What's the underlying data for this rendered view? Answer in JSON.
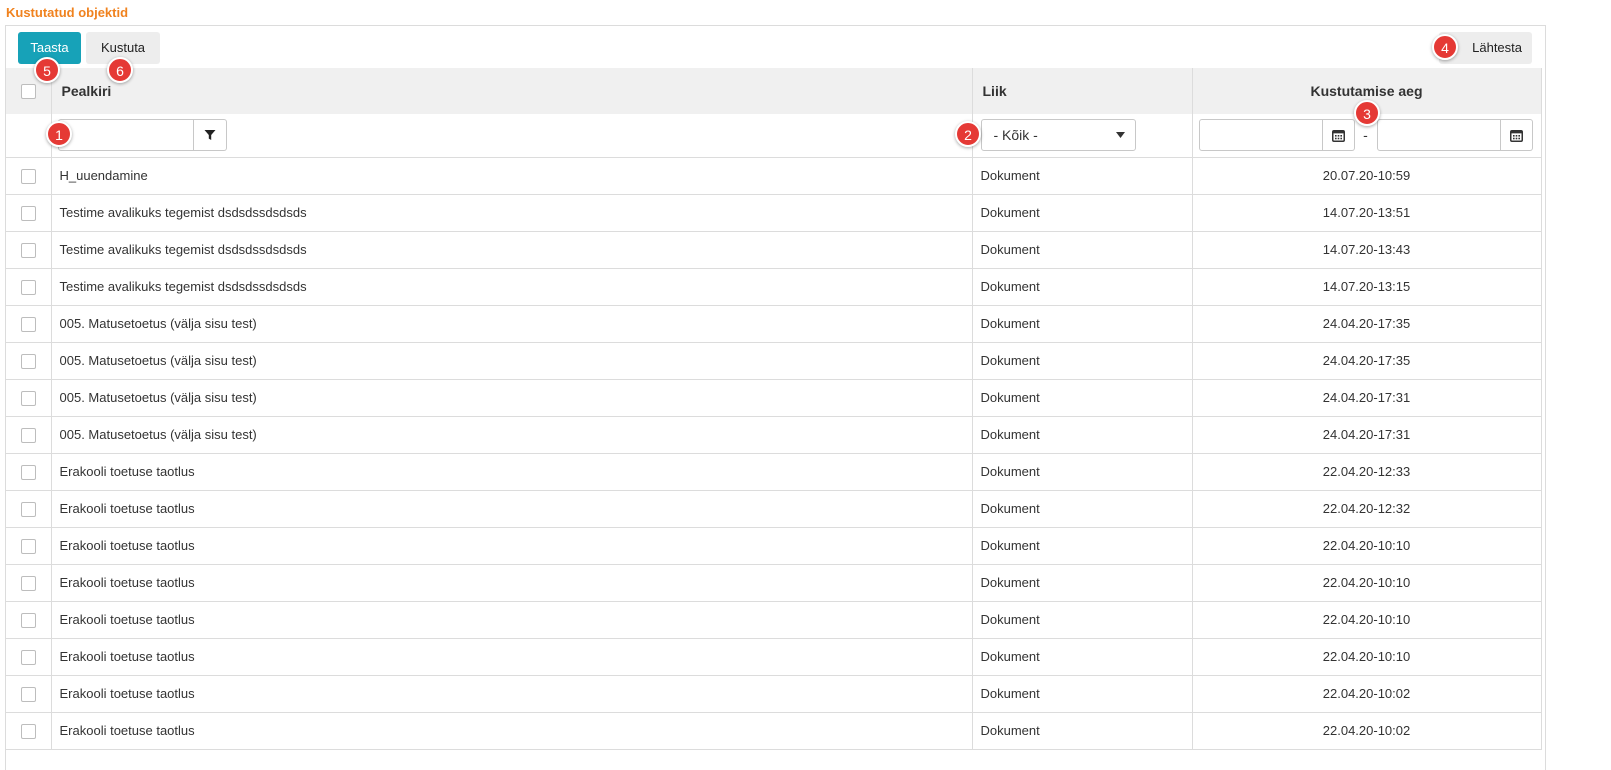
{
  "page": {
    "title": "Kustutatud objektid"
  },
  "toolbar": {
    "restore_label": "Taasta",
    "delete_label": "Kustuta",
    "reset_label": "Lähtesta"
  },
  "columns": {
    "title": "Pealkiri",
    "type": "Liik",
    "deleted_at": "Kustutamise aeg"
  },
  "filters": {
    "title_value": "",
    "type_selected": "- Kõik -",
    "date_from": "",
    "date_to": "",
    "range_separator": "-"
  },
  "annotations": [
    "1",
    "2",
    "3",
    "4",
    "5",
    "6"
  ],
  "rows": [
    {
      "title": "H_uuendamine",
      "type": "Dokument",
      "deleted_at": "20.07.20-10:59"
    },
    {
      "title": "Testime avalikuks tegemist dsdsdssdsdsds",
      "type": "Dokument",
      "deleted_at": "14.07.20-13:51"
    },
    {
      "title": "Testime avalikuks tegemist dsdsdssdsdsds",
      "type": "Dokument",
      "deleted_at": "14.07.20-13:43"
    },
    {
      "title": "Testime avalikuks tegemist dsdsdssdsdsds",
      "type": "Dokument",
      "deleted_at": "14.07.20-13:15"
    },
    {
      "title": "005. Matusetoetus (välja sisu test)",
      "type": "Dokument",
      "deleted_at": "24.04.20-17:35"
    },
    {
      "title": "005. Matusetoetus (välja sisu test)",
      "type": "Dokument",
      "deleted_at": "24.04.20-17:35"
    },
    {
      "title": "005. Matusetoetus (välja sisu test)",
      "type": "Dokument",
      "deleted_at": "24.04.20-17:31"
    },
    {
      "title": "005. Matusetoetus (välja sisu test)",
      "type": "Dokument",
      "deleted_at": "24.04.20-17:31"
    },
    {
      "title": "Erakooli toetuse taotlus",
      "type": "Dokument",
      "deleted_at": "22.04.20-12:33"
    },
    {
      "title": "Erakooli toetuse taotlus",
      "type": "Dokument",
      "deleted_at": "22.04.20-12:32"
    },
    {
      "title": "Erakooli toetuse taotlus",
      "type": "Dokument",
      "deleted_at": "22.04.20-10:10"
    },
    {
      "title": "Erakooli toetuse taotlus",
      "type": "Dokument",
      "deleted_at": "22.04.20-10:10"
    },
    {
      "title": "Erakooli toetuse taotlus",
      "type": "Dokument",
      "deleted_at": "22.04.20-10:10"
    },
    {
      "title": "Erakooli toetuse taotlus",
      "type": "Dokument",
      "deleted_at": "22.04.20-10:10"
    },
    {
      "title": "Erakooli toetuse taotlus",
      "type": "Dokument",
      "deleted_at": "22.04.20-10:02"
    },
    {
      "title": "Erakooli toetuse taotlus",
      "type": "Dokument",
      "deleted_at": "22.04.20-10:02"
    }
  ],
  "colors": {
    "title_accent": "#f0821e",
    "primary_button": "#17a2b8",
    "annotation_badge": "#e53935"
  },
  "icons": {
    "filter": "filter-icon",
    "calendar": "calendar-icon",
    "dropdown": "caret-down-icon"
  }
}
